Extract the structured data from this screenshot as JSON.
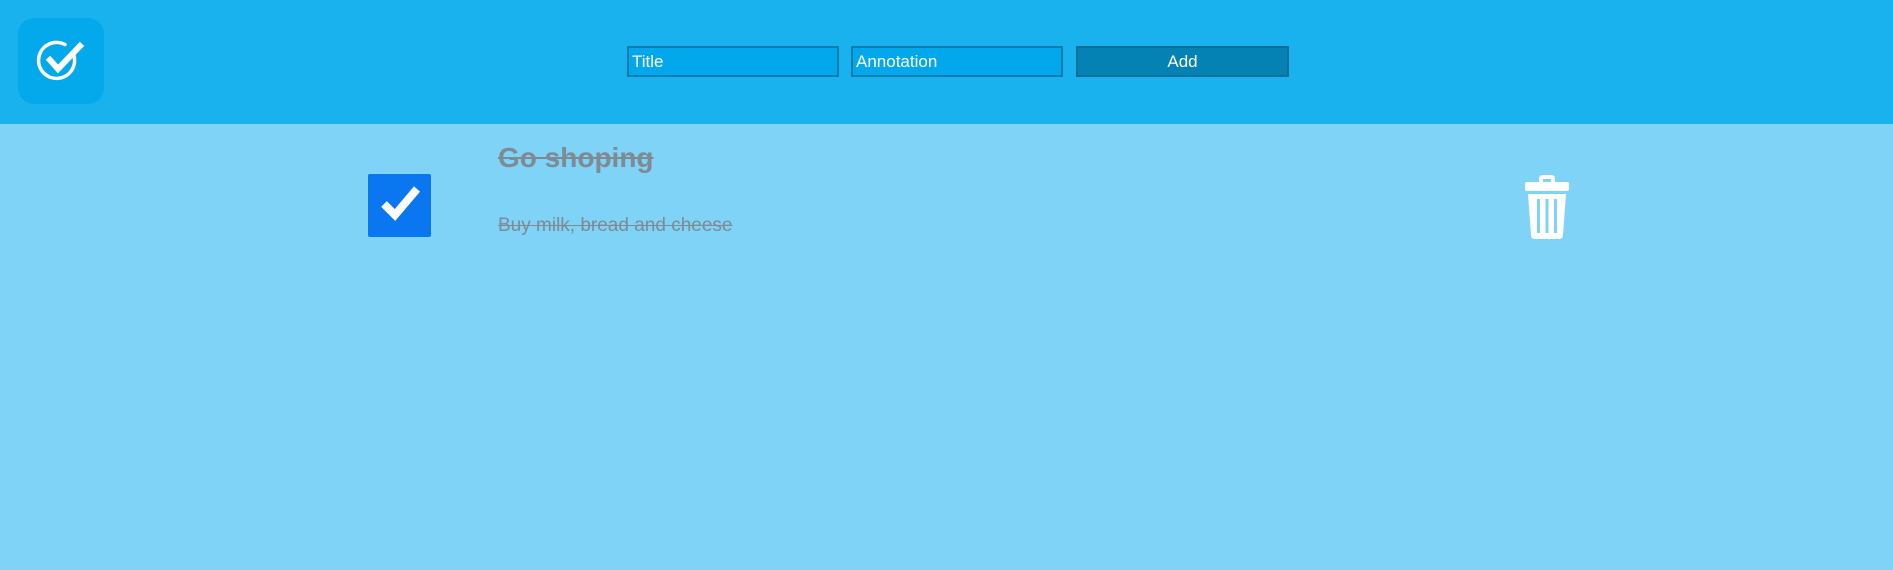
{
  "header": {
    "logo_icon": "check-circle-icon",
    "title_placeholder": "Title",
    "annotation_placeholder": "Annotation",
    "add_label": "Add"
  },
  "todos": [
    {
      "title": "Go shoping",
      "annotation": "Buy milk, bread and cheese",
      "completed": true,
      "delete_icon": "trash-icon"
    }
  ],
  "colors": {
    "header_background": "#1ab2ee",
    "page_background": "#7fd3f7",
    "checkbox_checked": "#0a76f0",
    "completed_text": "#7f8a92"
  }
}
